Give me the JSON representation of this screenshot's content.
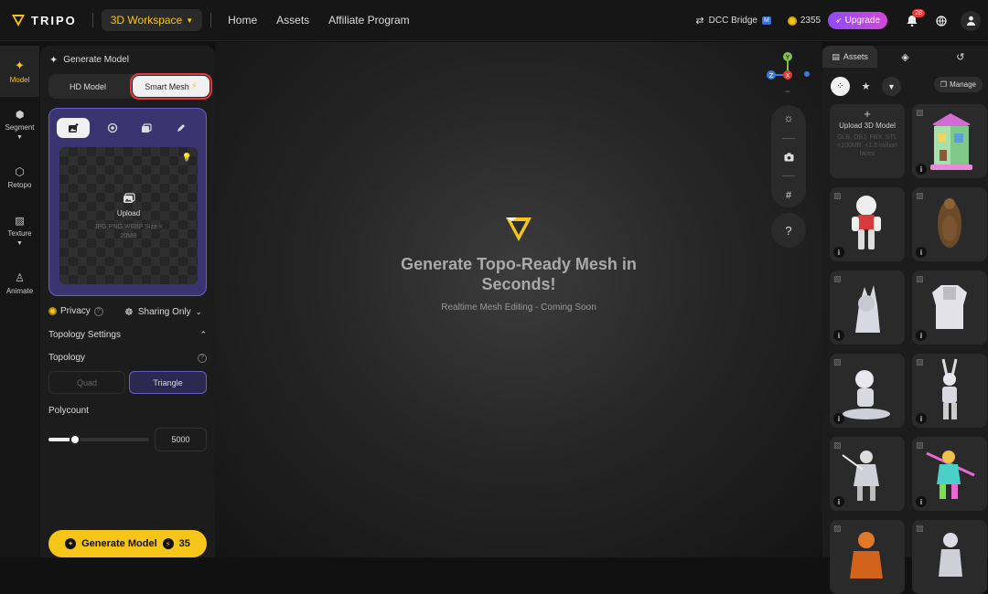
{
  "topbar": {
    "brand": "TRIPO",
    "workspace": "3D Workspace",
    "nav": [
      "Home",
      "Assets",
      "Affiliate Program"
    ],
    "dcc_bridge": "DCC Bridge",
    "dcc_badge": "M",
    "credits": "2355",
    "upgrade": "Upgrade",
    "notifications": "28"
  },
  "rail": {
    "items": [
      {
        "label": "Model",
        "icon": "sparkle-icon"
      },
      {
        "label": "Segment",
        "icon": "cube-icon"
      },
      {
        "label": "Retopo",
        "icon": "mesh-icon"
      },
      {
        "label": "Texture",
        "icon": "texture-icon"
      },
      {
        "label": "Animate",
        "icon": "figure-icon"
      }
    ]
  },
  "panel": {
    "title": "Generate Model",
    "mode_hd": "HD Model",
    "mode_smart": "Smart Mesh",
    "upload_label": "Upload",
    "upload_hint": "JPG,PNG,WEBP Size < 20MB",
    "privacy": "Privacy",
    "sharing": "Sharing Only",
    "topology_settings": "Topology Settings",
    "topology": "Topology",
    "quad": "Quad",
    "triangle": "Triangle",
    "polycount_label": "Polycount",
    "polycount": "5000",
    "polycount_fraction": 0.26,
    "generate": "Generate Model",
    "generate_cost": "35"
  },
  "viewport": {
    "headline": "Generate Topo-Ready Mesh in Seconds!",
    "sub": "Realtime Mesh Editing - Coming Soon",
    "help": "?",
    "gizmo": {
      "y": "Y",
      "x": "X",
      "z": "Z"
    }
  },
  "assets": {
    "tab_assets": "Assets",
    "manage": "Manage",
    "upload_title": "Upload 3D Model",
    "upload_hint": "GLB, OBJ, FBX, STL <100MB, <1.5 million faces",
    "info": "i"
  },
  "colors": {
    "accent": "#f5c518",
    "purple": "#6b5fc5",
    "highlight": "#e0393e"
  }
}
